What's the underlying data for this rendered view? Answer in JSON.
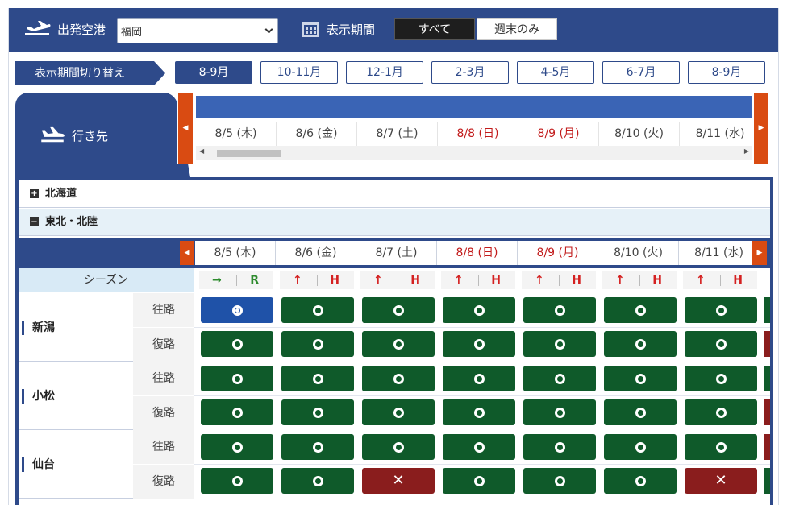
{
  "topbar": {
    "origin_label": "出発空港",
    "origin_value": "福岡",
    "period_label": "表示期間",
    "toggle_all": "すべて",
    "toggle_weekend": "週末のみ"
  },
  "period_switch": {
    "label": "表示期間切り替え",
    "buttons": [
      "8-9月",
      "10-11月",
      "12-1月",
      "2-3月",
      "4-5月",
      "6-7月",
      "8-9月"
    ],
    "active_index": 0
  },
  "destination_tab": {
    "label": "行き先"
  },
  "dates": [
    {
      "label": "8/5 (木)",
      "holiday": false
    },
    {
      "label": "8/6 (金)",
      "holiday": false
    },
    {
      "label": "8/7 (土)",
      "holiday": false
    },
    {
      "label": "8/8 (日)",
      "holiday": true
    },
    {
      "label": "8/9 (月)",
      "holiday": true
    },
    {
      "label": "8/10 (火)",
      "holiday": false
    },
    {
      "label": "8/11 (水)",
      "holiday": false
    }
  ],
  "regions": [
    {
      "name": "北海道",
      "expanded": false
    },
    {
      "name": "東北・北陸",
      "expanded": true
    }
  ],
  "season": {
    "label": "シーズン",
    "cells": [
      {
        "arrow": "→",
        "code": "R",
        "color": "green"
      },
      {
        "arrow": "↑",
        "code": "H",
        "color": "red"
      },
      {
        "arrow": "↑",
        "code": "H",
        "color": "red"
      },
      {
        "arrow": "↑",
        "code": "H",
        "color": "red"
      },
      {
        "arrow": "↑",
        "code": "H",
        "color": "red"
      },
      {
        "arrow": "↑",
        "code": "H",
        "color": "red"
      },
      {
        "arrow": "↑",
        "code": "H",
        "color": "red"
      }
    ]
  },
  "direction_labels": {
    "outbound": "往路",
    "return": "復路"
  },
  "cities": [
    {
      "name": "新潟",
      "outbound": [
        "selected",
        "available",
        "available",
        "available",
        "available",
        "available",
        "available"
      ],
      "return": [
        "available",
        "available",
        "available",
        "available",
        "available",
        "available",
        "available"
      ],
      "edge": [
        "available",
        "unavailable"
      ]
    },
    {
      "name": "小松",
      "outbound": [
        "available",
        "available",
        "available",
        "available",
        "available",
        "available",
        "available"
      ],
      "return": [
        "available",
        "available",
        "available",
        "available",
        "available",
        "available",
        "available"
      ],
      "edge": [
        "available",
        "unavailable"
      ]
    },
    {
      "name": "仙台",
      "outbound": [
        "available",
        "available",
        "available",
        "available",
        "available",
        "available",
        "available"
      ],
      "return": [
        "available",
        "available",
        "unavailable",
        "available",
        "available",
        "available",
        "unavailable"
      ],
      "edge": [
        "unavailable",
        "available"
      ]
    }
  ],
  "status_symbols": {
    "available": "○",
    "selected": "◉",
    "unavailable": "✕"
  },
  "colors": {
    "brand": "#2e4a8a",
    "accent": "#d94b12",
    "available": "#0f5a2a",
    "unavailable": "#8a1d1d",
    "selected": "#1f52a8",
    "holiday": "#c21b1b"
  }
}
